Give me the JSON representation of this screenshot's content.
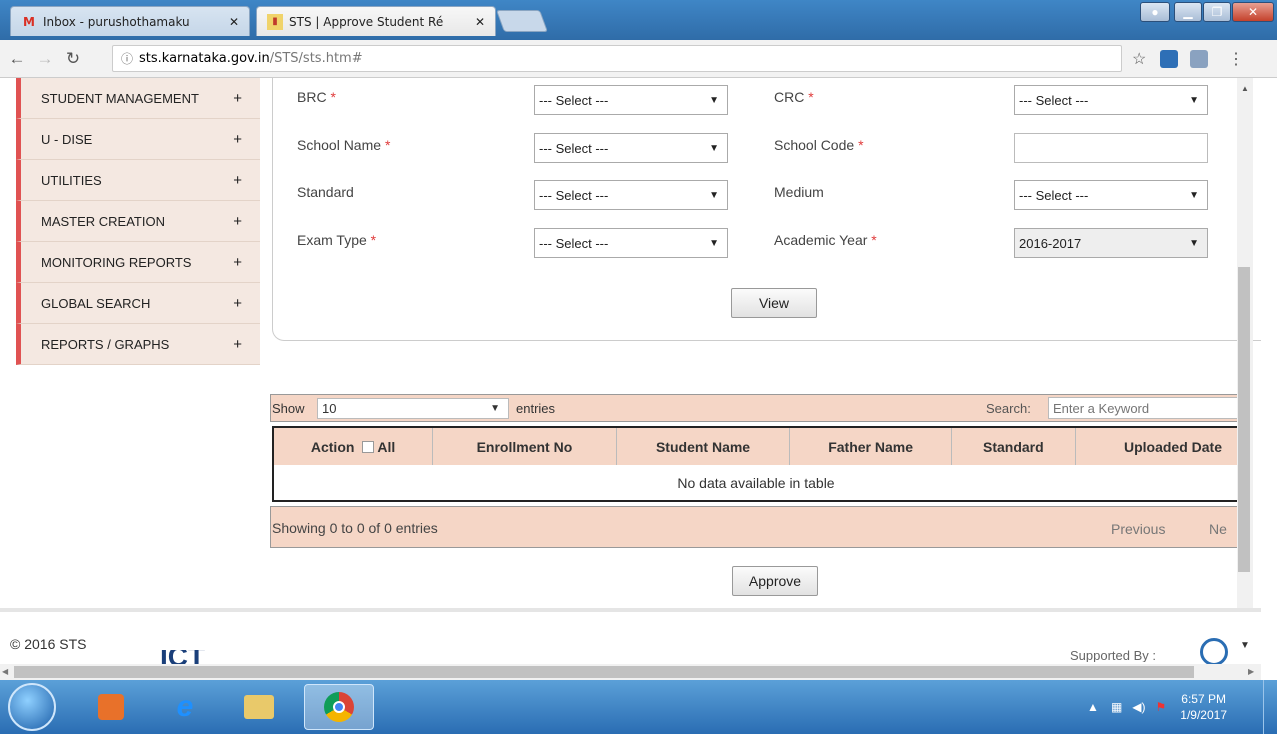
{
  "browser": {
    "tabs": [
      {
        "title": "Inbox - purushothamaku",
        "icon": "gmail-icon"
      },
      {
        "title": "STS | Approve Student Ré",
        "icon": "sts-favicon"
      }
    ],
    "url_host": "sts.karnataka.gov.in",
    "url_path": "/STS/sts.htm#"
  },
  "sidebar": {
    "items": [
      {
        "label": "STUDENT MANAGEMENT",
        "expand": "+"
      },
      {
        "label": "U - DISE",
        "expand": "+"
      },
      {
        "label": "UTILITIES",
        "expand": "+"
      },
      {
        "label": "MASTER CREATION",
        "expand": "+"
      },
      {
        "label": "MONITORING REPORTS",
        "expand": "+"
      },
      {
        "label": "GLOBAL SEARCH",
        "expand": "+"
      },
      {
        "label": "REPORTS / GRAPHS",
        "expand": "+"
      }
    ]
  },
  "form": {
    "brc_label": "BRC",
    "brc_value": "--- Select ---",
    "crc_label": "CRC",
    "crc_value": "--- Select ---",
    "school_name_label": "School Name",
    "school_name_value": "--- Select ---",
    "school_code_label": "School Code",
    "school_code_value": "",
    "standard_label": "Standard",
    "standard_value": "--- Select ---",
    "medium_label": "Medium",
    "medium_value": "--- Select ---",
    "exam_type_label": "Exam Type",
    "exam_type_value": "--- Select ---",
    "academic_year_label": "Academic Year",
    "academic_year_value": "2016-2017",
    "required_mark": "*",
    "view_button": "View"
  },
  "table": {
    "show_label": "Show",
    "entries_value": "10",
    "entries_label": "entries",
    "search_label": "Search:",
    "search_placeholder": "Enter a Keyword",
    "headers": {
      "action": "Action",
      "all": "All",
      "enrollment_no": "Enrollment No",
      "student_name": "Student Name",
      "father_name": "Father Name",
      "standard": "Standard",
      "uploaded_date": "Uploaded Date"
    },
    "empty_message": "No data available in table",
    "info": "Showing 0 to 0 of 0 entries",
    "previous": "Previous",
    "next": "Ne"
  },
  "approve_button": "Approve",
  "footer": {
    "copyright": "© 2016 STS",
    "logo_text": "ICT",
    "supported_by": "Supported By :"
  },
  "taskbar": {
    "time": "6:57 PM",
    "date": "1/9/2017"
  }
}
